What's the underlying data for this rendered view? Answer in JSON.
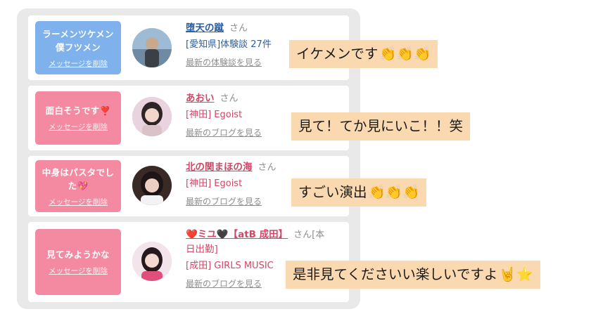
{
  "cards": [
    {
      "bubble_message": "ラーメンツケメン\n僕フツメン",
      "bubble_delete": "メッセージを削除",
      "bubble_color": "#7fb1ec",
      "name": "堕天の蹴",
      "name_suffix": "さん",
      "shop": "[愛知県]体験談 27件",
      "more_link": "最新の体験談を見る",
      "caption": "イケメンです",
      "caption_emoji": "👏👏👏"
    },
    {
      "bubble_message": "面白そうです❣️",
      "bubble_delete": "メッセージを削除",
      "bubble_color": "#f48aa1",
      "name": "あおい",
      "name_suffix": "さん",
      "shop": "[神田] Egoist",
      "more_link": "最新のブログを見る",
      "caption": "見て！てか見にいこ！！笑",
      "caption_emoji": ""
    },
    {
      "bubble_message": "中身はパスタでし\nた💖",
      "bubble_delete": "メッセージを削除",
      "bubble_color": "#f48aa1",
      "name": "北の関まほの海",
      "name_suffix": "さん",
      "shop": "[神田] Egoist",
      "more_link": "最新のブログを見る",
      "caption": "すごい演出",
      "caption_emoji": "👏👏👏"
    },
    {
      "bubble_message": "見てみようかな",
      "bubble_delete": "メッセージを削除",
      "bubble_color": "#f48aa1",
      "name_line1": "❤️ミユ🖤【atB 成田】",
      "name_suffix": "さん[本",
      "name_line2": "日出勤]",
      "shop": "[成田] GIRLS MUSIC",
      "more_link": "最新のブログを見る",
      "caption": "是非見てくださいい楽しいですよ",
      "caption_emoji": "🤘⭐"
    }
  ]
}
